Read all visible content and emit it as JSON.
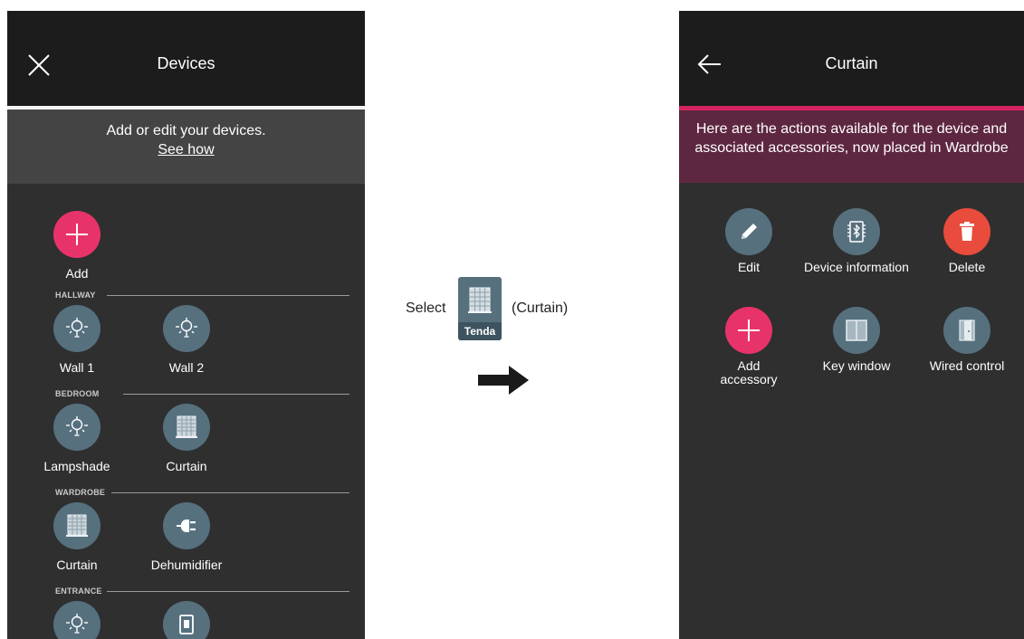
{
  "left_screen": {
    "title": "Devices",
    "banner": {
      "text": "Add or edit your devices.",
      "link": "See how"
    },
    "add_label": "Add",
    "sections": [
      {
        "name": "HALLWAY",
        "devices": [
          "Wall 1",
          "Wall 2"
        ]
      },
      {
        "name": "BEDROOM",
        "devices": [
          "Lampshade",
          "Curtain"
        ]
      },
      {
        "name": "WARDROBE",
        "devices": [
          "Curtain",
          "Dehumidifier"
        ]
      },
      {
        "name": "ENTRANCE",
        "devices": [
          "",
          ""
        ]
      }
    ]
  },
  "middle": {
    "select_text": "Select",
    "tile_label": "Tenda",
    "curtain_text": "(Curtain)"
  },
  "right_screen": {
    "title": "Curtain",
    "banner": "Here are the actions available for the device and associated accessories, now placed in Wardrobe",
    "actions": [
      {
        "label": "Edit",
        "icon": "pencil-icon"
      },
      {
        "label": "Device information",
        "icon": "bluetooth-chip-icon"
      },
      {
        "label": "Delete",
        "icon": "trash-icon"
      },
      {
        "label": "Add accessory",
        "icon": "plus-icon"
      },
      {
        "label": "Key window",
        "icon": "key-window-icon"
      },
      {
        "label": "Wired control",
        "icon": "wired-control-icon"
      }
    ]
  },
  "colors": {
    "header": "#1c1c1c",
    "background": "#2f2f2f",
    "accent_pink": "#e8336a",
    "delete_red": "#e94b3c",
    "icon_circle": "#56707e",
    "banner_right": "#5e2741"
  }
}
